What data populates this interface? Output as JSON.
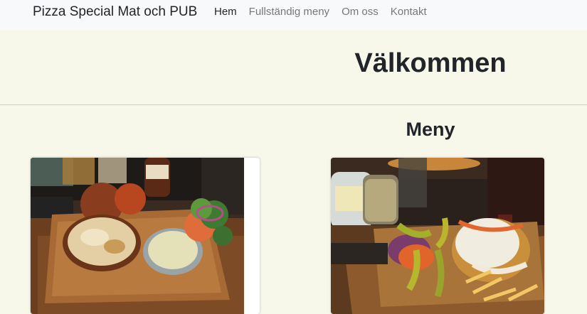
{
  "navbar": {
    "brand": "Pizza Special Mat och PUB",
    "links": [
      {
        "label": "Hem",
        "active": true
      },
      {
        "label": "Fullständig meny",
        "active": false
      },
      {
        "label": "Om oss",
        "active": false
      },
      {
        "label": "Kontakt",
        "active": false
      }
    ]
  },
  "hero": {
    "title": "Välkommen"
  },
  "menu_section": {
    "title": "Meny"
  },
  "cards": [
    {
      "image": "food-photo-gratin-platter"
    },
    {
      "image": "food-photo-kebab-fries-platter"
    }
  ],
  "colors": {
    "page_background": "#f7f7ea",
    "navbar_background": "#f8f9fa",
    "text": "#212529",
    "nav_link": "#777777"
  }
}
